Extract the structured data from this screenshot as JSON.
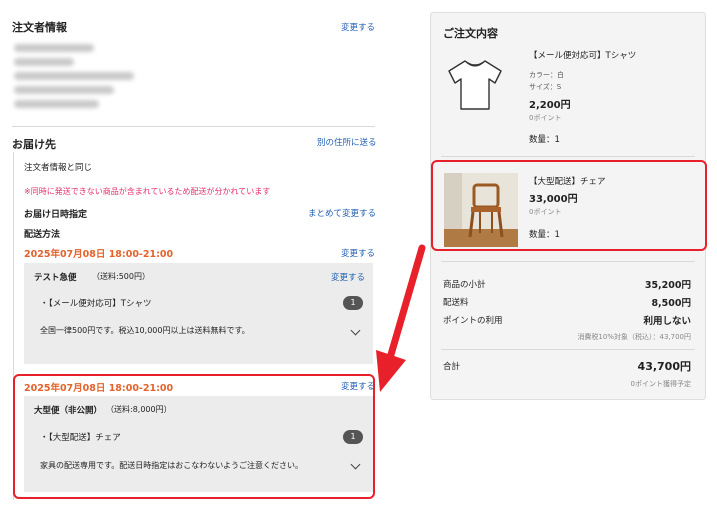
{
  "orderer": {
    "title": "注文者情報",
    "change_link": "変更する"
  },
  "delivery": {
    "title": "お届け先",
    "other_address_link": "別の住所に送る",
    "same_as_orderer": "注文者情報と同じ",
    "warning": "※同時に発送できない商品が含まれているため配送が分かれています",
    "datetime_label": "お届け日時指定",
    "bulk_change_link": "まとめて変更する",
    "method_label": "配送方法"
  },
  "shipments": [
    {
      "datetime": "2025年07月08日 18:00-21:00",
      "change_link": "変更する",
      "carrier": "テスト急便",
      "fee": "（送料:500円）",
      "carrier_change_link": "変更する",
      "item": "・【メール便対応可】Tシャツ",
      "qty": "1",
      "note": "全国一律500円です。税込10,000円以上は送料無料です。"
    },
    {
      "datetime": "2025年07月08日 18:00-21:00",
      "change_link": "変更する",
      "carrier": "大型便（非公開）",
      "fee": "（送料:8,000円）",
      "item": "・【大型配送】チェア",
      "qty": "1",
      "note": "家具の配送専用です。配送日時指定はおこなわないようご注意ください。"
    }
  ],
  "summary": {
    "title": "ご注文内容",
    "products": [
      {
        "name": "【メール便対応可】Tシャツ",
        "color": "カラー：白",
        "size": "サイズ：S",
        "price": "2,200円",
        "points": "0ポイント",
        "qty": "数量：1",
        "icon": "tshirt-icon"
      },
      {
        "name": "【大型配送】チェア",
        "price": "33,000円",
        "points": "0ポイント",
        "qty": "数量：1",
        "icon": "chair-photo"
      }
    ],
    "subtotal_label": "商品の小計",
    "subtotal": "35,200円",
    "shipping_label": "配送料",
    "shipping": "8,500円",
    "points_label": "ポイントの利用",
    "points_value": "利用しない",
    "tax_note": "消費税10%対象（税込）：43,700円",
    "total_label": "合計",
    "total": "43,700円",
    "points_earned": "0ポイント獲得予定"
  },
  "colors": {
    "accent_link": "#1f5fb4",
    "orange": "#e4622b",
    "warning": "#e52f6b",
    "highlight": "#e8202a"
  }
}
